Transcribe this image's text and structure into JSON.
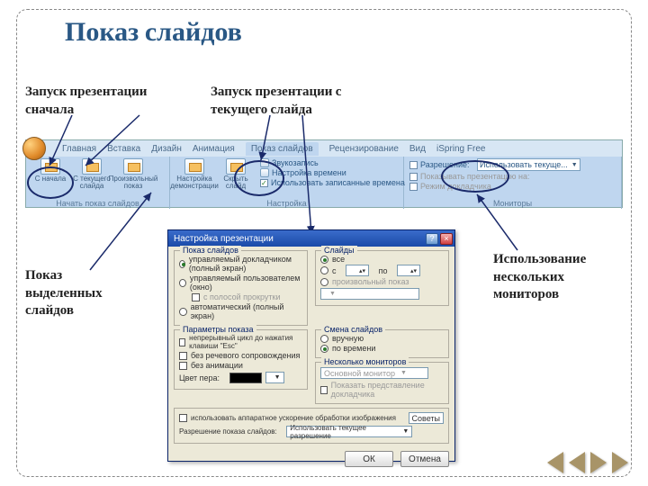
{
  "title": "Показ слайдов",
  "labels": {
    "l1": "Запуск презентации сначала",
    "l2": "Запуск презентации с текущего слайда",
    "l3": "Показ выделенных слайдов",
    "l4": "Использование нескольких мониторов"
  },
  "ribbon": {
    "tabs": [
      "Главная",
      "Вставка",
      "Дизайн",
      "Анимация",
      "Показ слайдов",
      "Рецензирование",
      "Вид",
      "iSpring Free"
    ],
    "g1": {
      "b1": "С начала",
      "b2": "С текущего слайда",
      "b3": "Произвольный показ",
      "title": "Начать показ слайдов"
    },
    "g2": {
      "b1": "Настройка демонстрации",
      "b2": "Скрыть слайд",
      "v1": "Звукозапись",
      "v2": "Настройка времени",
      "v3": "Использовать записанные времена",
      "title": "Настройка"
    },
    "g3": {
      "c1": "Разрешение:",
      "c2": "Показывать презентацию на:",
      "c3": "Режим докладчика",
      "drop": "Использовать текуще...",
      "title": "Мониторы"
    }
  },
  "dialog": {
    "title": "Настройка презентации",
    "fs1": {
      "legend": "Показ слайдов",
      "r1": "управляемый докладчиком (полный экран)",
      "r2": "управляемый пользователем (окно)",
      "c1": "с полосой прокрутки",
      "r3": "автоматический (полный экран)"
    },
    "fs2": {
      "legend": "Слайды",
      "r1": "все",
      "r2_a": "с",
      "r2_b": "по",
      "r3": "произвольный показ"
    },
    "fs3": {
      "legend": "Параметры показа",
      "c1": "непрерывный цикл до нажатия клавиши \"Esc\"",
      "c2": "без речевого сопровождения",
      "c3": "без анимации",
      "pen": "Цвет пера:"
    },
    "fs4": {
      "legend": "Смена слайдов",
      "r1": "вручную",
      "r2": "по времени"
    },
    "fs5": {
      "legend": "Несколько мониторов",
      "drop": "Основной монитор",
      "c1": "Показать представление докладчика"
    },
    "perf": {
      "c1": "использовать аппаратное ускорение обработки изображения",
      "lbl": "Разрешение показа слайдов:",
      "drop": "Использовать текущее разрешение",
      "tips": "Советы"
    },
    "ok": "ОК",
    "cancel": "Отмена"
  }
}
